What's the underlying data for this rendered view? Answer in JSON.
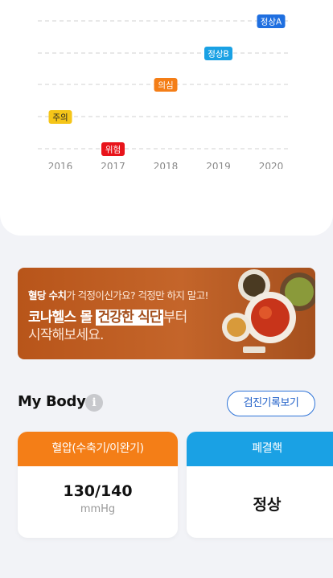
{
  "chart_data": {
    "type": "scatter",
    "categories": [
      "2016",
      "2017",
      "2018",
      "2019",
      "2020"
    ],
    "levels": [
      "위험",
      "주의",
      "의심",
      "정상B",
      "정상A"
    ],
    "points": [
      {
        "x": "2016",
        "label": "주의",
        "color": "#f5c518",
        "text_color": "#222222"
      },
      {
        "x": "2017",
        "label": "위험",
        "color": "#e8141b",
        "text_color": "#ffffff"
      },
      {
        "x": "2018",
        "label": "의심",
        "color": "#f47e17",
        "text_color": "#ffffff"
      },
      {
        "x": "2019",
        "label": "정상B",
        "color": "#1aa1e4",
        "text_color": "#ffffff"
      },
      {
        "x": "2020",
        "label": "정상A",
        "color": "#1f6fe0",
        "text_color": "#ffffff"
      }
    ],
    "grid": true
  },
  "banner": {
    "line1_bold": "혈당 수치",
    "line1_rest": "가 걱정이신가요? 걱정만 하지 말고!",
    "line2_a": "코나헬스 몰",
    "line2_highlight": "건강한 식단",
    "line2_b": "부터",
    "line3": "시작해보세요."
  },
  "my_body": {
    "title": "My Body",
    "info_icon": "i",
    "record_button": "검진기록보기",
    "cards": [
      {
        "header": "혈압(수축기/이완기)",
        "value": "130/140",
        "unit": "mmHg",
        "color": "#f47e17"
      },
      {
        "header": "폐결핵",
        "value": "정상",
        "color": "#1aa1e4"
      }
    ]
  }
}
